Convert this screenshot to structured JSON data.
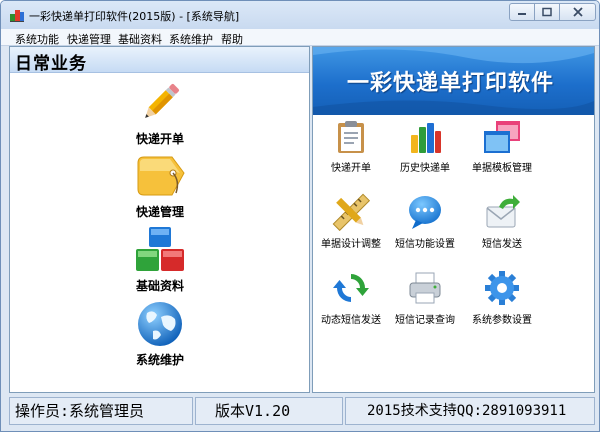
{
  "window": {
    "title": "一彩快递单打印软件(2015版) - [系统导航]"
  },
  "menu": [
    "系统功能",
    "快递管理",
    "基础资料",
    "系统维护",
    "帮助"
  ],
  "left_panel": {
    "header": "日常业务",
    "items": [
      {
        "label": "快递开单",
        "icon": "pencil-icon"
      },
      {
        "label": "快递管理",
        "icon": "tag-icon"
      },
      {
        "label": "基础资料",
        "icon": "blocks-icon"
      },
      {
        "label": "系统维护",
        "icon": "globe-icon"
      }
    ]
  },
  "right_panel": {
    "banner": "一彩快递单打印软件",
    "items": [
      {
        "label": "快递开单",
        "icon": "clipboard-icon"
      },
      {
        "label": "历史快递单",
        "icon": "bar-chart-icon"
      },
      {
        "label": "单据模板管理",
        "icon": "windows-icon"
      },
      {
        "label": "单据设计调整",
        "icon": "ruler-pencil-icon"
      },
      {
        "label": "短信功能设置",
        "icon": "chat-bubble-icon"
      },
      {
        "label": "短信发送",
        "icon": "envelope-arrow-icon"
      },
      {
        "label": "动态短信发送",
        "icon": "refresh-icon"
      },
      {
        "label": "短信记录查询",
        "icon": "printer-icon"
      },
      {
        "label": "系统参数设置",
        "icon": "gear-icon"
      }
    ]
  },
  "status": {
    "operator": "操作员:系统管理员",
    "version": "版本V1.20",
    "support": "2015技术支持QQ:2891093911"
  }
}
